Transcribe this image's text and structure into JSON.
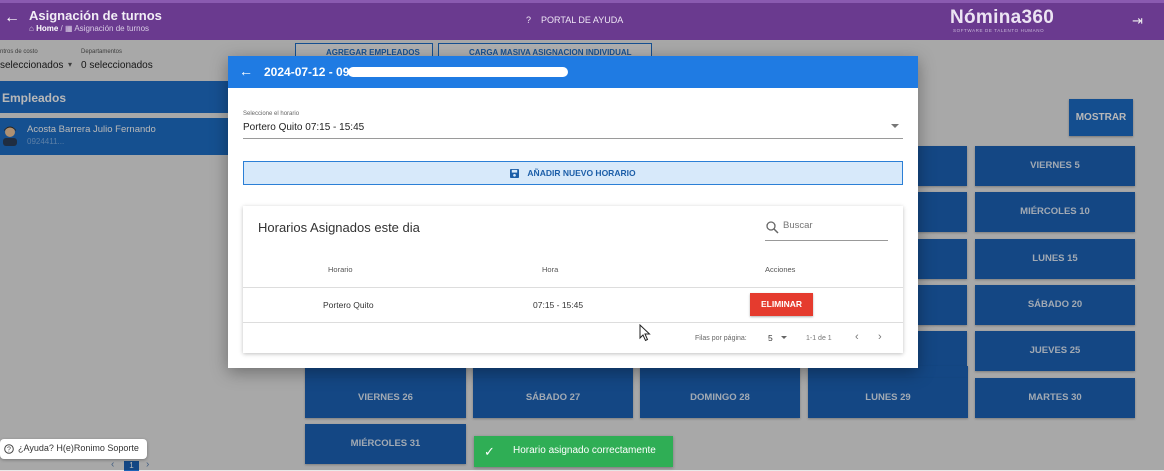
{
  "header": {
    "title": "Asignación de turnos",
    "breadcrumb_home": "Home",
    "breadcrumb_current": "Asignación de turnos",
    "help_portal": "PORTAL DE AYUDA",
    "logo": "Nómina360",
    "logo_tagline": "SOFTWARE DE TALENTO HUMANO"
  },
  "filters": {
    "centros_label": "ntros de costo",
    "centros_value": "seleccionados",
    "departamentos_label": "Departamentos",
    "departamentos_value": "0 seleccionados"
  },
  "toolbar": {
    "add_employees": "AGREGAR EMPLEADOS",
    "bulk_upload": "CARGA MASIVA ASIGNACION INDIVIDUAL",
    "show": "MOSTRAR"
  },
  "sidebar": {
    "title": "Empleados",
    "employee_name": "Acosta Barrera Julio Fernando",
    "employee_id": "0924411..."
  },
  "calendar": {
    "days": [
      "VIERNES 5",
      "MIÉRCOLES 10",
      "LUNES 15",
      "SÁBADO 20",
      "JUEVES 25",
      "VIERNES 26",
      "SÁBADO 27",
      "DOMINGO 28",
      "LUNES 29",
      "MARTES 30",
      "MIÉRCOLES 31"
    ]
  },
  "modal": {
    "title": "2024-07-12 - 0924411...",
    "select_label": "Seleccione el horario",
    "select_value": "Portero Quito 07:15 - 15:45",
    "add_button": "AÑADIR NUEVO HORARIO",
    "card_title": "Horarios Asignados este dia",
    "search_placeholder": "Buscar",
    "columns": [
      "Horario",
      "Hora",
      "Acciones"
    ],
    "rows": [
      {
        "horario": "Portero Quito",
        "hora": "07:15 - 15:45",
        "action": "ELIMINAR"
      }
    ],
    "pagination": {
      "rows_per_page_label": "Filas por página:",
      "rows_per_page": "5",
      "range": "1-1 de 1"
    }
  },
  "help": {
    "text": "¿Ayuda? H(e)Ronimo Soporte"
  },
  "page_indicator": "1",
  "toast": {
    "text": "Horario asignado correctamente"
  },
  "colors": {
    "header": "#6a3a8f",
    "primary": "#1f7be3",
    "day_button": "#1c63b8",
    "danger": "#e53b2e",
    "success": "#2fae55"
  }
}
